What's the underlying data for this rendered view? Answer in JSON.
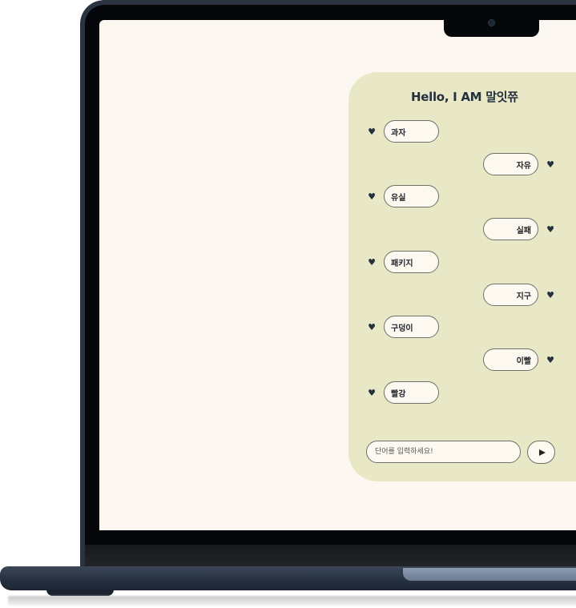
{
  "chat": {
    "title": "Hello, I AM 말잇쮸",
    "heart_icon": "heart-icon",
    "messages": [
      {
        "side": "left",
        "text": "과자"
      },
      {
        "side": "right",
        "text": "자유"
      },
      {
        "side": "left",
        "text": "유실"
      },
      {
        "side": "right",
        "text": "실패"
      },
      {
        "side": "left",
        "text": "패키지"
      },
      {
        "side": "right",
        "text": "지구"
      },
      {
        "side": "left",
        "text": "구덩이"
      },
      {
        "side": "right",
        "text": "이빨"
      },
      {
        "side": "left",
        "text": "빨강"
      }
    ]
  },
  "input": {
    "placeholder": "단어를 입력하세요!",
    "value": ""
  },
  "send": {
    "icon": "play-icon"
  },
  "colors": {
    "panel": "#e9e8c6",
    "screen": "#fcf8f1",
    "bubble": "#fdf9f1",
    "text_dark": "#24303d",
    "laptop_body": "#253040"
  }
}
